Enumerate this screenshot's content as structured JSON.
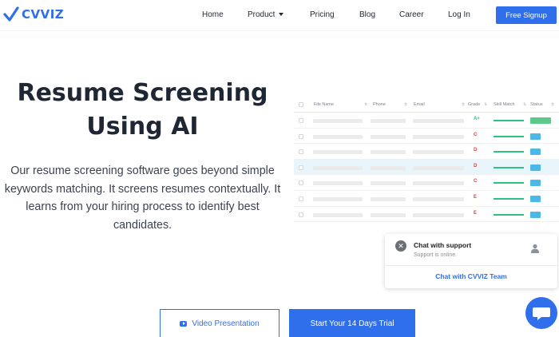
{
  "brand": {
    "name": "CVVIZ",
    "accent": "#2f6fec"
  },
  "nav": {
    "items": [
      {
        "label": "Home"
      },
      {
        "label": "Product"
      },
      {
        "label": "Pricing"
      },
      {
        "label": "Blog"
      },
      {
        "label": "Career"
      },
      {
        "label": "Log In"
      }
    ],
    "cta": "Free Signup"
  },
  "hero": {
    "title_line1": "Resume Screening",
    "title_line2": "Using AI",
    "description": "Our resume screening software goes beyond simple keywords matching. It screens resumes contextually. It learns from your hiring process to identify best candidates."
  },
  "table": {
    "columns": [
      "File Name",
      "Phone",
      "Email",
      "Grade",
      "Skill Match",
      "Status"
    ],
    "rows": [
      {
        "grade": "A+",
        "grade_color": "#2ec27e",
        "status_color": "#5cc98a"
      },
      {
        "grade": "C",
        "grade_color": "#e0413a",
        "status_color": "#4db8e8"
      },
      {
        "grade": "D",
        "grade_color": "#e0413a",
        "status_color": "#4db8e8"
      },
      {
        "grade": "D",
        "grade_color": "#e0413a",
        "status_color": "#4db8e8"
      },
      {
        "grade": "C",
        "grade_color": "#e0413a",
        "status_color": "#4db8e8"
      },
      {
        "grade": "E",
        "grade_color": "#e0413a",
        "status_color": "#4db8e8"
      },
      {
        "grade": "E",
        "grade_color": "#e0413a",
        "status_color": "#4db8e8"
      }
    ]
  },
  "chat": {
    "title": "Chat with support",
    "subtitle": "Support is online.",
    "link": "Chat with CVVIZ Team"
  },
  "cta": {
    "video": "Video Presentation",
    "trial": "Start Your 14 Days Trial"
  },
  "icons": {
    "logo": "check-mark-logo-icon",
    "product_dropdown": "chevron-down-icon",
    "chat_close": "close-icon",
    "chat_avatar": "user-icon",
    "chat_bubble": "chat-bubble-icon",
    "video": "youtube-play-icon"
  }
}
